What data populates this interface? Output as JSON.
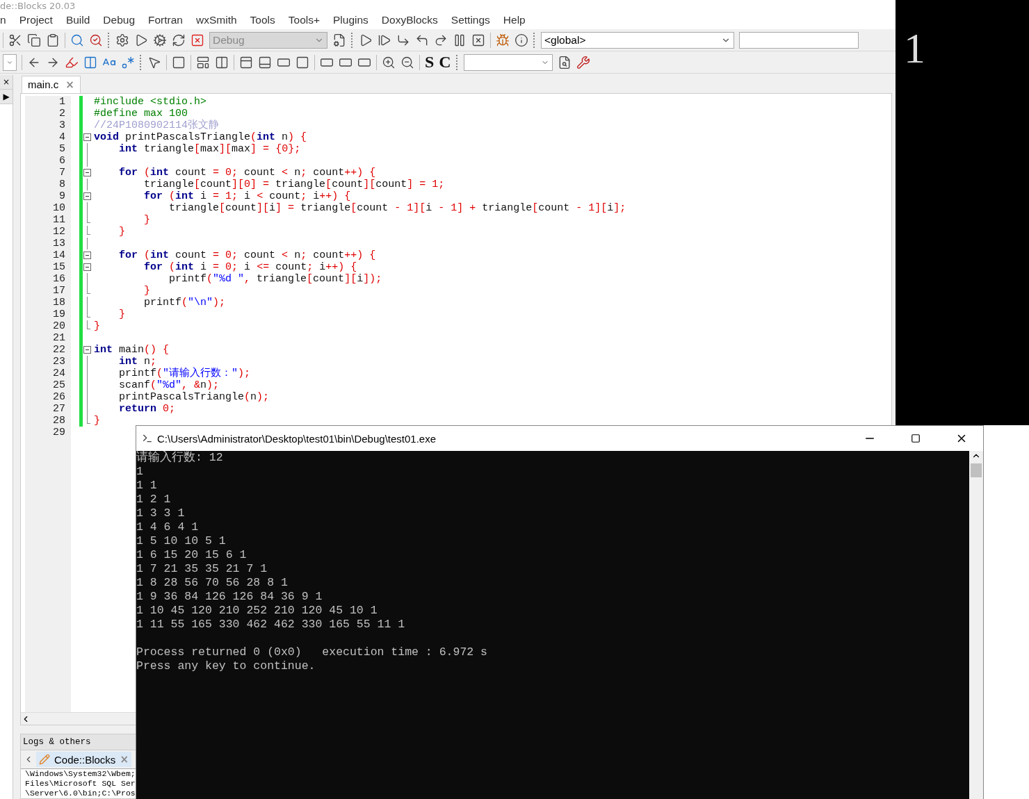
{
  "window": {
    "title": "de::Blocks 20.03"
  },
  "menu": [
    "n",
    "Project",
    "Build",
    "Debug",
    "Fortran",
    "wxSmith",
    "Tools",
    "Tools+",
    "Plugins",
    "DoxyBlocks",
    "Settings",
    "Help"
  ],
  "toolbar": {
    "build_target": {
      "value": "Debug",
      "disabled": true
    },
    "scope": {
      "value": "<global>"
    },
    "letters": [
      "S",
      "C"
    ]
  },
  "side_panel": {
    "close": "×",
    "expand": "▶"
  },
  "editor": {
    "tabs": [
      {
        "label": "main.c",
        "close": "×",
        "selected": true
      }
    ],
    "lines": [
      {
        "n": "1",
        "tokens": [
          {
            "kind": "pp",
            "text": "#include <stdio.h>"
          }
        ]
      },
      {
        "n": "2",
        "tokens": [
          {
            "kind": "pp",
            "text": "#define max 100"
          }
        ]
      },
      {
        "n": "3",
        "tokens": [
          {
            "kind": "cm",
            "text": "//24P1080902114张文静"
          }
        ]
      },
      {
        "n": "4",
        "gutter": {
          "kind": "start"
        },
        "tokens": [
          {
            "kind": "kw",
            "text": "void"
          },
          {
            "kind": "id",
            "text": " printPascalsTriangle"
          },
          {
            "kind": "op",
            "text": "("
          },
          {
            "kind": "kw",
            "text": "int"
          },
          {
            "kind": "id",
            "text": " n"
          },
          {
            "kind": "op",
            "text": ")"
          },
          {
            "kind": "op",
            "text": " {"
          }
        ]
      },
      {
        "n": "5",
        "gutter": {
          "kind": "line"
        },
        "tokens": [
          {
            "kind": "kw",
            "text": "    int"
          },
          {
            "kind": "id",
            "text": " triangle"
          },
          {
            "kind": "op",
            "text": "["
          },
          {
            "kind": "id",
            "text": "max"
          },
          {
            "kind": "op",
            "text": "]["
          },
          {
            "kind": "id",
            "text": "max"
          },
          {
            "kind": "op",
            "text": "]"
          },
          {
            "kind": "op",
            "text": " ="
          },
          {
            "kind": "op",
            "text": " {0};"
          }
        ]
      },
      {
        "n": "6",
        "gutter": {
          "kind": "line"
        }
      },
      {
        "n": "7",
        "gutter": {
          "kind": "start"
        },
        "tokens": [
          {
            "kind": "kw",
            "text": "    for"
          },
          {
            "kind": "op",
            "text": " ("
          },
          {
            "kind": "kw",
            "text": "int"
          },
          {
            "kind": "id",
            "text": " count "
          },
          {
            "kind": "op",
            "text": "="
          },
          {
            "kind": "op",
            "text": " 0;"
          },
          {
            "kind": "id",
            "text": " count "
          },
          {
            "kind": "op",
            "text": "<"
          },
          {
            "kind": "id",
            "text": " n"
          },
          {
            "kind": "op",
            "text": ";"
          },
          {
            "kind": "id",
            "text": " count"
          },
          {
            "kind": "op",
            "text": "++)"
          },
          {
            "kind": "op",
            "text": " {"
          }
        ]
      },
      {
        "n": "8",
        "gutter": {
          "kind": "line"
        },
        "tokens": [
          {
            "kind": "id",
            "text": "        triangle"
          },
          {
            "kind": "op",
            "text": "["
          },
          {
            "kind": "id",
            "text": "count"
          },
          {
            "kind": "op",
            "text": "][0]"
          },
          {
            "kind": "op",
            "text": " ="
          },
          {
            "kind": "id",
            "text": " triangle"
          },
          {
            "kind": "op",
            "text": "["
          },
          {
            "kind": "id",
            "text": "count"
          },
          {
            "kind": "op",
            "text": "]["
          },
          {
            "kind": "id",
            "text": "count"
          },
          {
            "kind": "op",
            "text": "]"
          },
          {
            "kind": "op",
            "text": " ="
          },
          {
            "kind": "op",
            "text": " 1;"
          }
        ]
      },
      {
        "n": "9",
        "gutter": {
          "kind": "start"
        },
        "tokens": [
          {
            "kind": "kw",
            "text": "        for"
          },
          {
            "kind": "op",
            "text": " ("
          },
          {
            "kind": "kw",
            "text": "int"
          },
          {
            "kind": "id",
            "text": " i "
          },
          {
            "kind": "op",
            "text": "="
          },
          {
            "kind": "op",
            "text": " 1;"
          },
          {
            "kind": "id",
            "text": " i "
          },
          {
            "kind": "op",
            "text": "<"
          },
          {
            "kind": "id",
            "text": " count"
          },
          {
            "kind": "op",
            "text": ";"
          },
          {
            "kind": "id",
            "text": " i"
          },
          {
            "kind": "op",
            "text": "++)"
          },
          {
            "kind": "op",
            "text": " {"
          }
        ]
      },
      {
        "n": "10",
        "gutter": {
          "kind": "line"
        },
        "tokens": [
          {
            "kind": "id",
            "text": "            triangle"
          },
          {
            "kind": "op",
            "text": "["
          },
          {
            "kind": "id",
            "text": "count"
          },
          {
            "kind": "op",
            "text": "]["
          },
          {
            "kind": "id",
            "text": "i"
          },
          {
            "kind": "op",
            "text": "]"
          },
          {
            "kind": "op",
            "text": " ="
          },
          {
            "kind": "id",
            "text": " triangle"
          },
          {
            "kind": "op",
            "text": "["
          },
          {
            "kind": "id",
            "text": "count "
          },
          {
            "kind": "op",
            "text": "-"
          },
          {
            "kind": "op",
            "text": " 1]["
          },
          {
            "kind": "id",
            "text": "i "
          },
          {
            "kind": "op",
            "text": "-"
          },
          {
            "kind": "op",
            "text": " 1]"
          },
          {
            "kind": "op",
            "text": " +"
          },
          {
            "kind": "id",
            "text": " triangle"
          },
          {
            "kind": "op",
            "text": "["
          },
          {
            "kind": "id",
            "text": "count "
          },
          {
            "kind": "op",
            "text": "-"
          },
          {
            "kind": "op",
            "text": " 1]["
          },
          {
            "kind": "id",
            "text": "i"
          },
          {
            "kind": "op",
            "text": "];"
          }
        ]
      },
      {
        "n": "11",
        "gutter": {
          "kind": "end"
        },
        "tokens": [
          {
            "kind": "op",
            "text": "        }"
          }
        ]
      },
      {
        "n": "12",
        "gutter": {
          "kind": "end"
        },
        "tokens": [
          {
            "kind": "op",
            "text": "    }"
          }
        ]
      },
      {
        "n": "13",
        "gutter": {
          "kind": "line"
        }
      },
      {
        "n": "14",
        "gutter": {
          "kind": "start"
        },
        "tokens": [
          {
            "kind": "kw",
            "text": "    for"
          },
          {
            "kind": "op",
            "text": " ("
          },
          {
            "kind": "kw",
            "text": "int"
          },
          {
            "kind": "id",
            "text": " count "
          },
          {
            "kind": "op",
            "text": "="
          },
          {
            "kind": "op",
            "text": " 0;"
          },
          {
            "kind": "id",
            "text": " count "
          },
          {
            "kind": "op",
            "text": "<"
          },
          {
            "kind": "id",
            "text": " n"
          },
          {
            "kind": "op",
            "text": ";"
          },
          {
            "kind": "id",
            "text": " count"
          },
          {
            "kind": "op",
            "text": "++)"
          },
          {
            "kind": "op",
            "text": " {"
          }
        ]
      },
      {
        "n": "15",
        "gutter": {
          "kind": "start"
        },
        "tokens": [
          {
            "kind": "kw",
            "text": "        for"
          },
          {
            "kind": "op",
            "text": " ("
          },
          {
            "kind": "kw",
            "text": "int"
          },
          {
            "kind": "id",
            "text": " i "
          },
          {
            "kind": "op",
            "text": "="
          },
          {
            "kind": "op",
            "text": " 0;"
          },
          {
            "kind": "id",
            "text": " i "
          },
          {
            "kind": "op",
            "text": "<="
          },
          {
            "kind": "id",
            "text": " count"
          },
          {
            "kind": "op",
            "text": ";"
          },
          {
            "kind": "id",
            "text": " i"
          },
          {
            "kind": "op",
            "text": "++)"
          },
          {
            "kind": "op",
            "text": " {"
          }
        ]
      },
      {
        "n": "16",
        "gutter": {
          "kind": "line"
        },
        "tokens": [
          {
            "kind": "id",
            "text": "            printf"
          },
          {
            "kind": "op",
            "text": "("
          },
          {
            "kind": "str",
            "text": "\"%d \""
          },
          {
            "kind": "op",
            "text": ","
          },
          {
            "kind": "id",
            "text": " triangle"
          },
          {
            "kind": "op",
            "text": "["
          },
          {
            "kind": "id",
            "text": "count"
          },
          {
            "kind": "op",
            "text": "]["
          },
          {
            "kind": "id",
            "text": "i"
          },
          {
            "kind": "op",
            "text": "]);"
          }
        ]
      },
      {
        "n": "17",
        "gutter": {
          "kind": "end"
        },
        "tokens": [
          {
            "kind": "op",
            "text": "        }"
          }
        ]
      },
      {
        "n": "18",
        "gutter": {
          "kind": "line"
        },
        "tokens": [
          {
            "kind": "id",
            "text": "        printf"
          },
          {
            "kind": "op",
            "text": "("
          },
          {
            "kind": "str",
            "text": "\"\\n\""
          },
          {
            "kind": "op",
            "text": ");"
          }
        ]
      },
      {
        "n": "19",
        "gutter": {
          "kind": "end"
        },
        "tokens": [
          {
            "kind": "op",
            "text": "    }"
          }
        ]
      },
      {
        "n": "20",
        "gutter": {
          "kind": "end"
        },
        "tokens": [
          {
            "kind": "op",
            "text": "}"
          }
        ]
      },
      {
        "n": "21"
      },
      {
        "n": "22",
        "gutter": {
          "kind": "start"
        },
        "tokens": [
          {
            "kind": "kw",
            "text": "int"
          },
          {
            "kind": "id",
            "text": " main"
          },
          {
            "kind": "op",
            "text": "()"
          },
          {
            "kind": "op",
            "text": " {"
          }
        ]
      },
      {
        "n": "23",
        "gutter": {
          "kind": "line"
        },
        "tokens": [
          {
            "kind": "kw",
            "text": "    int"
          },
          {
            "kind": "id",
            "text": " n"
          },
          {
            "kind": "op",
            "text": ";"
          }
        ]
      },
      {
        "n": "24",
        "gutter": {
          "kind": "line"
        },
        "tokens": [
          {
            "kind": "id",
            "text": "    printf"
          },
          {
            "kind": "op",
            "text": "("
          },
          {
            "kind": "str",
            "text": "\"请输入行数：\""
          },
          {
            "kind": "op",
            "text": ");"
          }
        ]
      },
      {
        "n": "25",
        "gutter": {
          "kind": "line"
        },
        "tokens": [
          {
            "kind": "id",
            "text": "    scanf"
          },
          {
            "kind": "op",
            "text": "("
          },
          {
            "kind": "str",
            "text": "\"%d\""
          },
          {
            "kind": "op",
            "text": ","
          },
          {
            "kind": "op",
            "text": " &"
          },
          {
            "kind": "id",
            "text": "n"
          },
          {
            "kind": "op",
            "text": ");"
          }
        ]
      },
      {
        "n": "26",
        "gutter": {
          "kind": "line"
        },
        "tokens": [
          {
            "kind": "id",
            "text": "    printPascalsTriangle"
          },
          {
            "kind": "op",
            "text": "("
          },
          {
            "kind": "id",
            "text": "n"
          },
          {
            "kind": "op",
            "text": ");"
          }
        ]
      },
      {
        "n": "27",
        "gutter": {
          "kind": "line"
        },
        "tokens": [
          {
            "kind": "kw",
            "text": "    return"
          },
          {
            "kind": "op",
            "text": " 0;"
          }
        ]
      },
      {
        "n": "28",
        "gutter": {
          "kind": "end"
        },
        "tokens": [
          {
            "kind": "op",
            "text": "}"
          }
        ]
      },
      {
        "n": "29"
      }
    ]
  },
  "logs": {
    "title": "Logs & others",
    "tabs": [
      {
        "label": "Code::Blocks",
        "close": "×",
        "selected": true
      }
    ],
    "lines": [
      "\\Windows\\System32\\Wbem;",
      "Files\\Microsoft SQL Ser",
      "\\Server\\6.0\\bin;C:\\Pros"
    ]
  },
  "background_window": {
    "text": "1"
  },
  "console": {
    "title": "C:\\Users\\Administrator\\Desktop\\test01\\bin\\Debug\\test01.exe",
    "lines": [
      "请输入行数: 12",
      "1",
      "1 1",
      "1 2 1",
      "1 3 3 1",
      "1 4 6 4 1",
      "1 5 10 10 5 1",
      "1 6 15 20 15 6 1",
      "1 7 21 35 35 21 7 1",
      "1 8 28 56 70 56 28 8 1",
      "1 9 36 84 126 126 84 36 9 1",
      "1 10 45 120 210 252 210 120 45 10 1",
      "1 11 55 165 330 462 462 330 165 55 11 1"
    ],
    "status": [
      "Process returned 0 (0x0)   execution time : 6.972 s",
      "Press any key to continue."
    ]
  }
}
